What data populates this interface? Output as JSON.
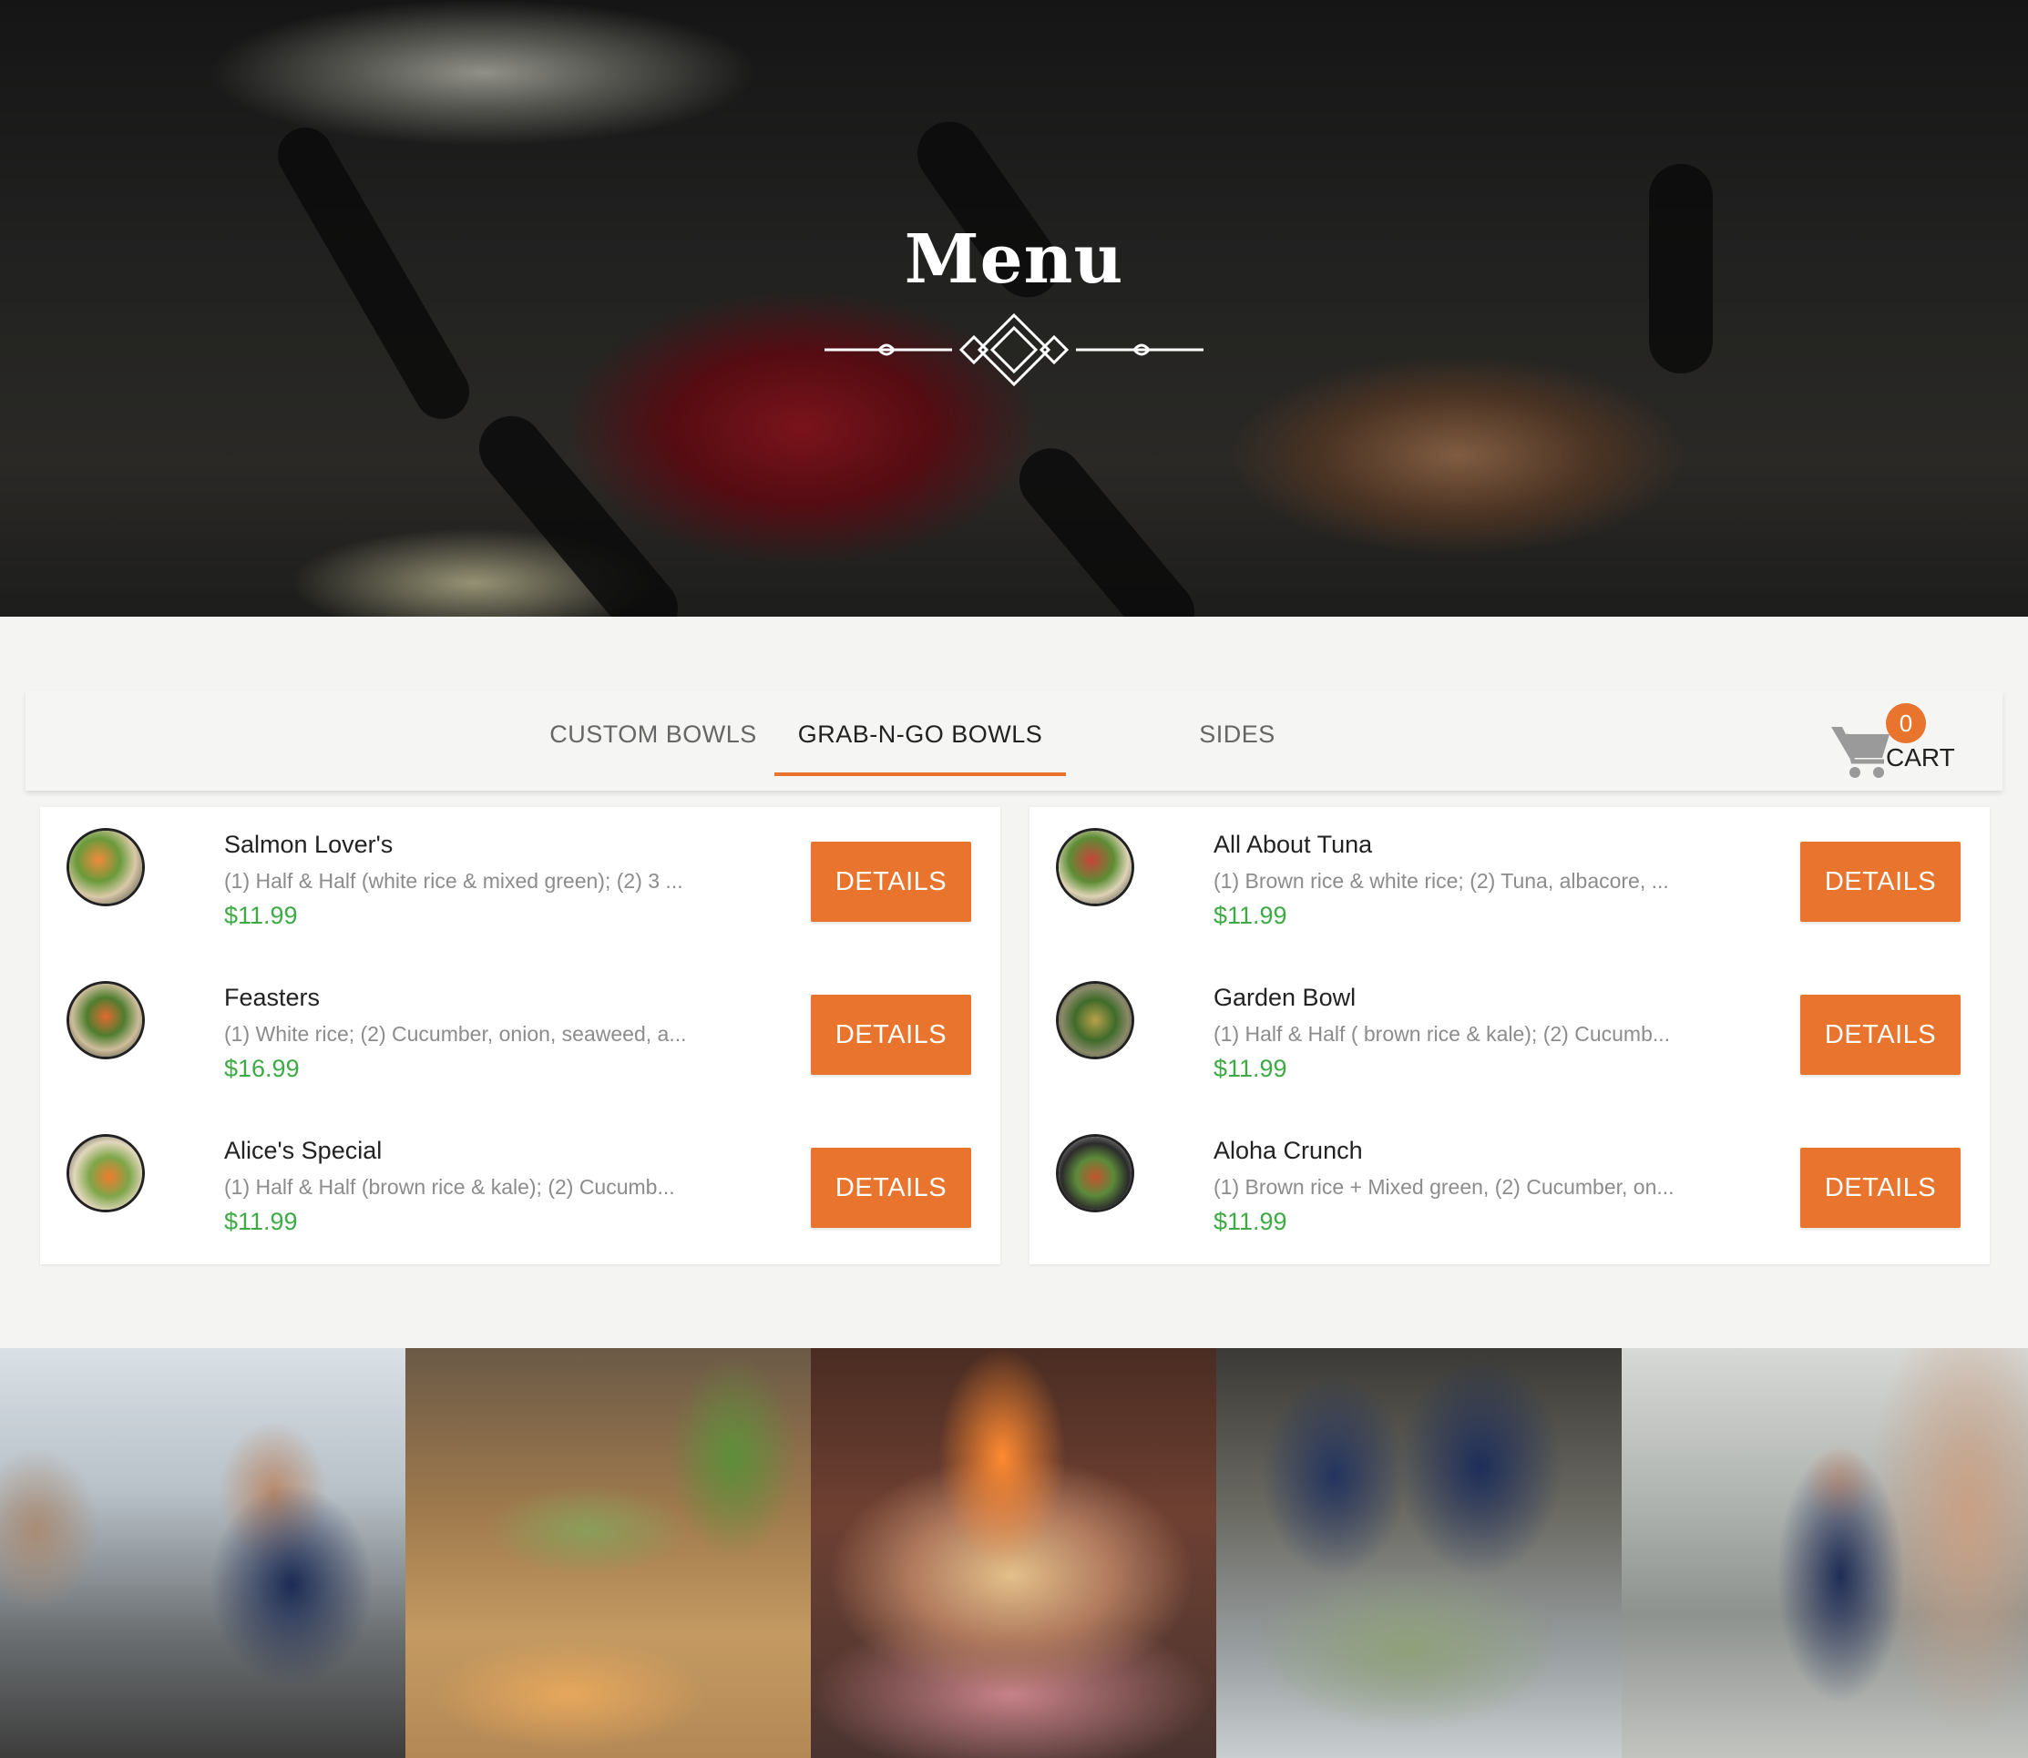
{
  "hero": {
    "title": "Menu"
  },
  "tabs": [
    {
      "label": "CUSTOM BOWLS",
      "active": false
    },
    {
      "label": "GRAB-N-GO BOWLS",
      "active": true
    },
    {
      "label": "SIDES",
      "active": false
    }
  ],
  "cart": {
    "count": "0",
    "label": "CART"
  },
  "colors": {
    "accent": "#e8742e",
    "price": "#3daa45"
  },
  "menu": {
    "left": [
      {
        "name": "Salmon Lover's",
        "desc": "(1) Half & Half (white rice & mixed green); (2) 3 ...",
        "price": "$11.99",
        "button": "DETAILS"
      },
      {
        "name": "Feasters",
        "desc": "(1) White rice; (2) Cucumber, onion, seaweed, a...",
        "price": "$16.99",
        "button": "DETAILS"
      },
      {
        "name": "Alice's Special",
        "desc": "(1) Half & Half (brown rice & kale); (2) Cucumb...",
        "price": "$11.99",
        "button": "DETAILS"
      }
    ],
    "right": [
      {
        "name": "All About Tuna",
        "desc": "(1) Brown rice & white rice; (2) Tuna, albacore, ...",
        "price": "$11.99",
        "button": "DETAILS"
      },
      {
        "name": "Garden Bowl",
        "desc": "(1) Half & Half ( brown rice & kale); (2) Cucumb...",
        "price": "$11.99",
        "button": "DETAILS"
      },
      {
        "name": "Aloha Crunch",
        "desc": "(1) Brown rice + Mixed green, (2) Cucumber, on...",
        "price": "$11.99",
        "button": "DETAILS"
      }
    ]
  },
  "photos": [
    "restaurant-counter-photo",
    "spam-musubi-photo",
    "torched-fish-photo",
    "staff-prep-photo",
    "street-bowl-photo"
  ]
}
